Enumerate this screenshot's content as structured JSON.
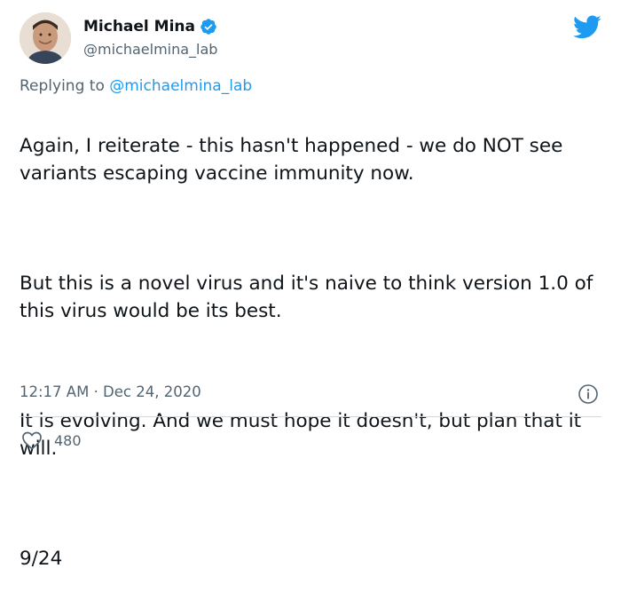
{
  "author": {
    "display_name": "Michael Mina",
    "handle": "@michaelmina_lab",
    "verified": true
  },
  "reply": {
    "prefix": "Replying to",
    "mention": "@michaelmina_lab"
  },
  "tweet": {
    "paragraphs": [
      "Again, I reiterate - this hasn't happened - we do NOT see variants escaping vaccine immunity now.",
      "But this is a novel virus and it's naive to think version 1.0 of this virus would be its best.",
      "It is evolving. And we must hope it doesn't, but plan that it will.",
      "9/24"
    ],
    "timestamp": "12:17 AM · Dec 24, 2020",
    "likes": "480"
  },
  "icons": {
    "brand": "twitter-bird-icon",
    "verified": "verified-badge-icon",
    "info": "info-icon",
    "like": "heart-icon"
  },
  "colors": {
    "brand_blue": "#1d9bf0",
    "text": "#0f1419",
    "secondary": "#536471",
    "divider": "#cfd9de"
  }
}
